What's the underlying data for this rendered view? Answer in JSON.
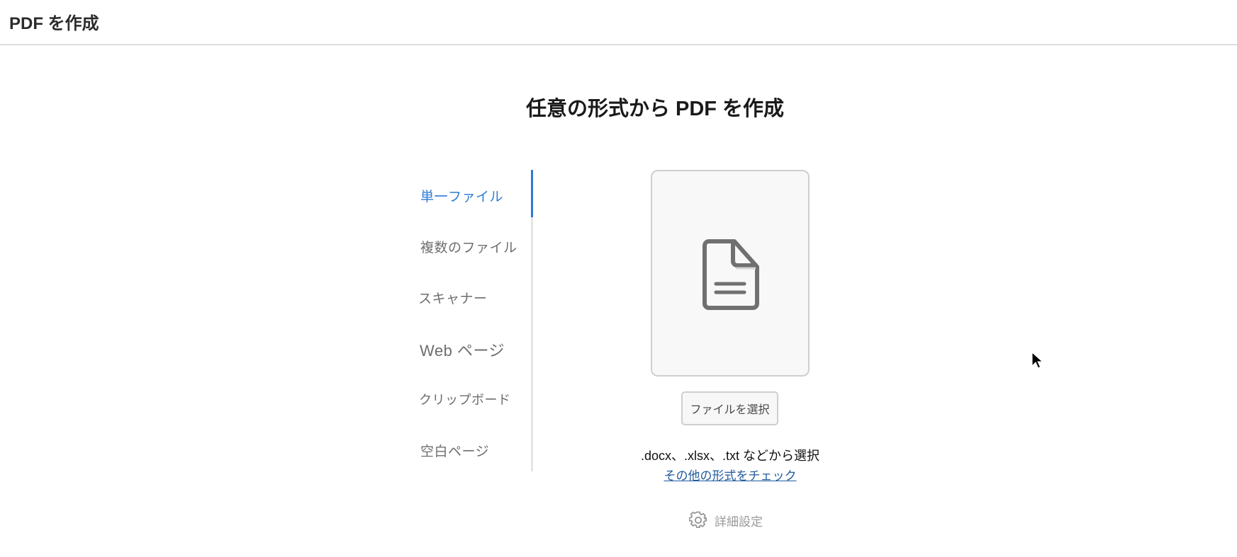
{
  "header": {
    "title": "PDF を作成"
  },
  "main": {
    "heading": "任意の形式から PDF を作成",
    "tabs": [
      {
        "label": "単一ファイル",
        "active": true
      },
      {
        "label": "複数のファイル"
      },
      {
        "label": "スキャナー"
      },
      {
        "label": "Web ページ"
      },
      {
        "label": "クリップボード"
      },
      {
        "label": "空白ページ"
      }
    ],
    "drop_icon": "document-icon",
    "select_button": "ファイルを選択",
    "formats_text": ".docx、.xlsx、.txt などから選択",
    "more_formats_link": "その他の形式をチェック",
    "settings_label": "詳細設定",
    "settings_icon": "gear-icon"
  },
  "colors": {
    "accent": "#2d7ad6",
    "link": "#1f5a9c"
  }
}
